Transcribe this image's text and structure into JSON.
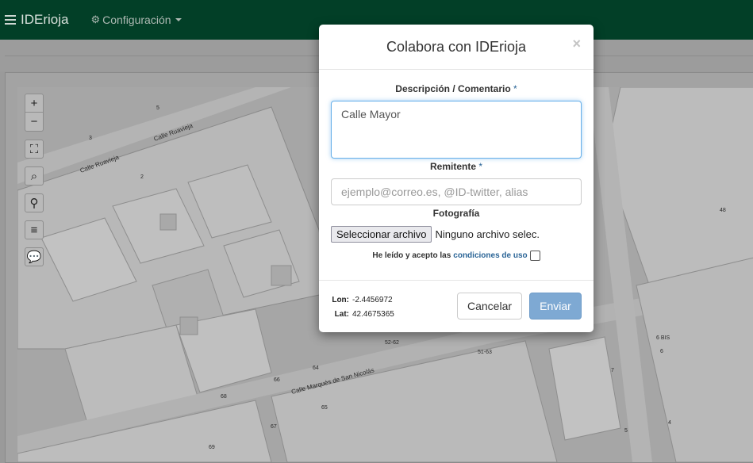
{
  "navbar": {
    "brand": "IDErioja",
    "config_label": "Configuración"
  },
  "map": {
    "streets": [
      "Calle Ruavieja",
      "Calle Ruavieja",
      "Calle Marqués de San Nicolás"
    ],
    "house_numbers": [
      "5",
      "3",
      "2",
      "48",
      "52-62",
      "51-63",
      "64",
      "66",
      "68",
      "65",
      "67",
      "69",
      "6 BIS",
      "6",
      "7",
      "4",
      "5"
    ]
  },
  "map_tools": {
    "zoom_in": "+",
    "zoom_out": "−",
    "fullscreen": "⛶",
    "search": "⌕",
    "locate": "⚲",
    "layers": "≡",
    "comment": "💬"
  },
  "modal": {
    "title": "Colabora con IDErioja",
    "close": "×",
    "description_label": "Descripción / Comentario",
    "required_mark": "*",
    "description_value": "Calle Mayor",
    "sender_label": "Remitente",
    "sender_placeholder": "ejemplo@correo.es, @ID-twitter, alias",
    "photo_label": "Fotografía",
    "file_button": "Seleccionar archivo",
    "file_status": "Ninguno archivo selec.",
    "terms_text": "He leído y acepto las",
    "terms_link": "condiciones de uso",
    "terms_checked": false,
    "lon_label": "Lon:",
    "lon_value": "-2.4456972",
    "lat_label": "Lat:",
    "lat_value": "42.4675365",
    "cancel_label": "Cancelar",
    "send_label": "Enviar"
  },
  "colors": {
    "navbar": "#023f27",
    "primary_button": "#7ea9d3",
    "link": "#2a6496",
    "focus_border": "#66afe9"
  }
}
